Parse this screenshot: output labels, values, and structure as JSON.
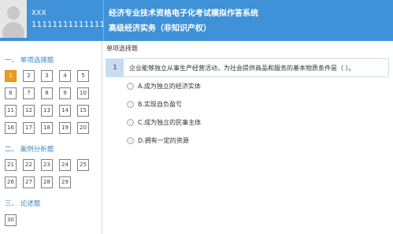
{
  "user": {
    "name": "XXX",
    "id": "11111111111111"
  },
  "app": {
    "title": "经济专业技术资格电子化考试模拟作答系统",
    "subtitle": "高级经济实务（非知识产权）"
  },
  "sidebar": {
    "sections": [
      {
        "title": "一、 单项选择题",
        "numbers": [
          "1",
          "2",
          "3",
          "4",
          "5",
          "6",
          "7",
          "8",
          "9",
          "10",
          "11",
          "12",
          "13",
          "14",
          "15",
          "16",
          "17",
          "18",
          "19",
          "20"
        ]
      },
      {
        "title": "二、 案例分析题",
        "numbers": [
          "21",
          "22",
          "23",
          "24",
          "25",
          "26",
          "27",
          "28",
          "29"
        ]
      },
      {
        "title": "三、 论述题",
        "numbers": [
          "30"
        ]
      }
    ],
    "active": "1"
  },
  "main": {
    "type_label": "单项选择题",
    "question": {
      "number": "1",
      "text": "企业能够独立从事生产经营活动，为社会提供商品和服务的基本物质条件是（ ）。"
    },
    "options": [
      "A.成为独立的经济实体",
      "B.实现自负盈亏",
      "C.成为独立的民事主体",
      "D.拥有一定的资源"
    ]
  },
  "colors": {
    "header": "#3f92d8",
    "accent": "#f39a1d",
    "section_title": "#3a86c8"
  }
}
